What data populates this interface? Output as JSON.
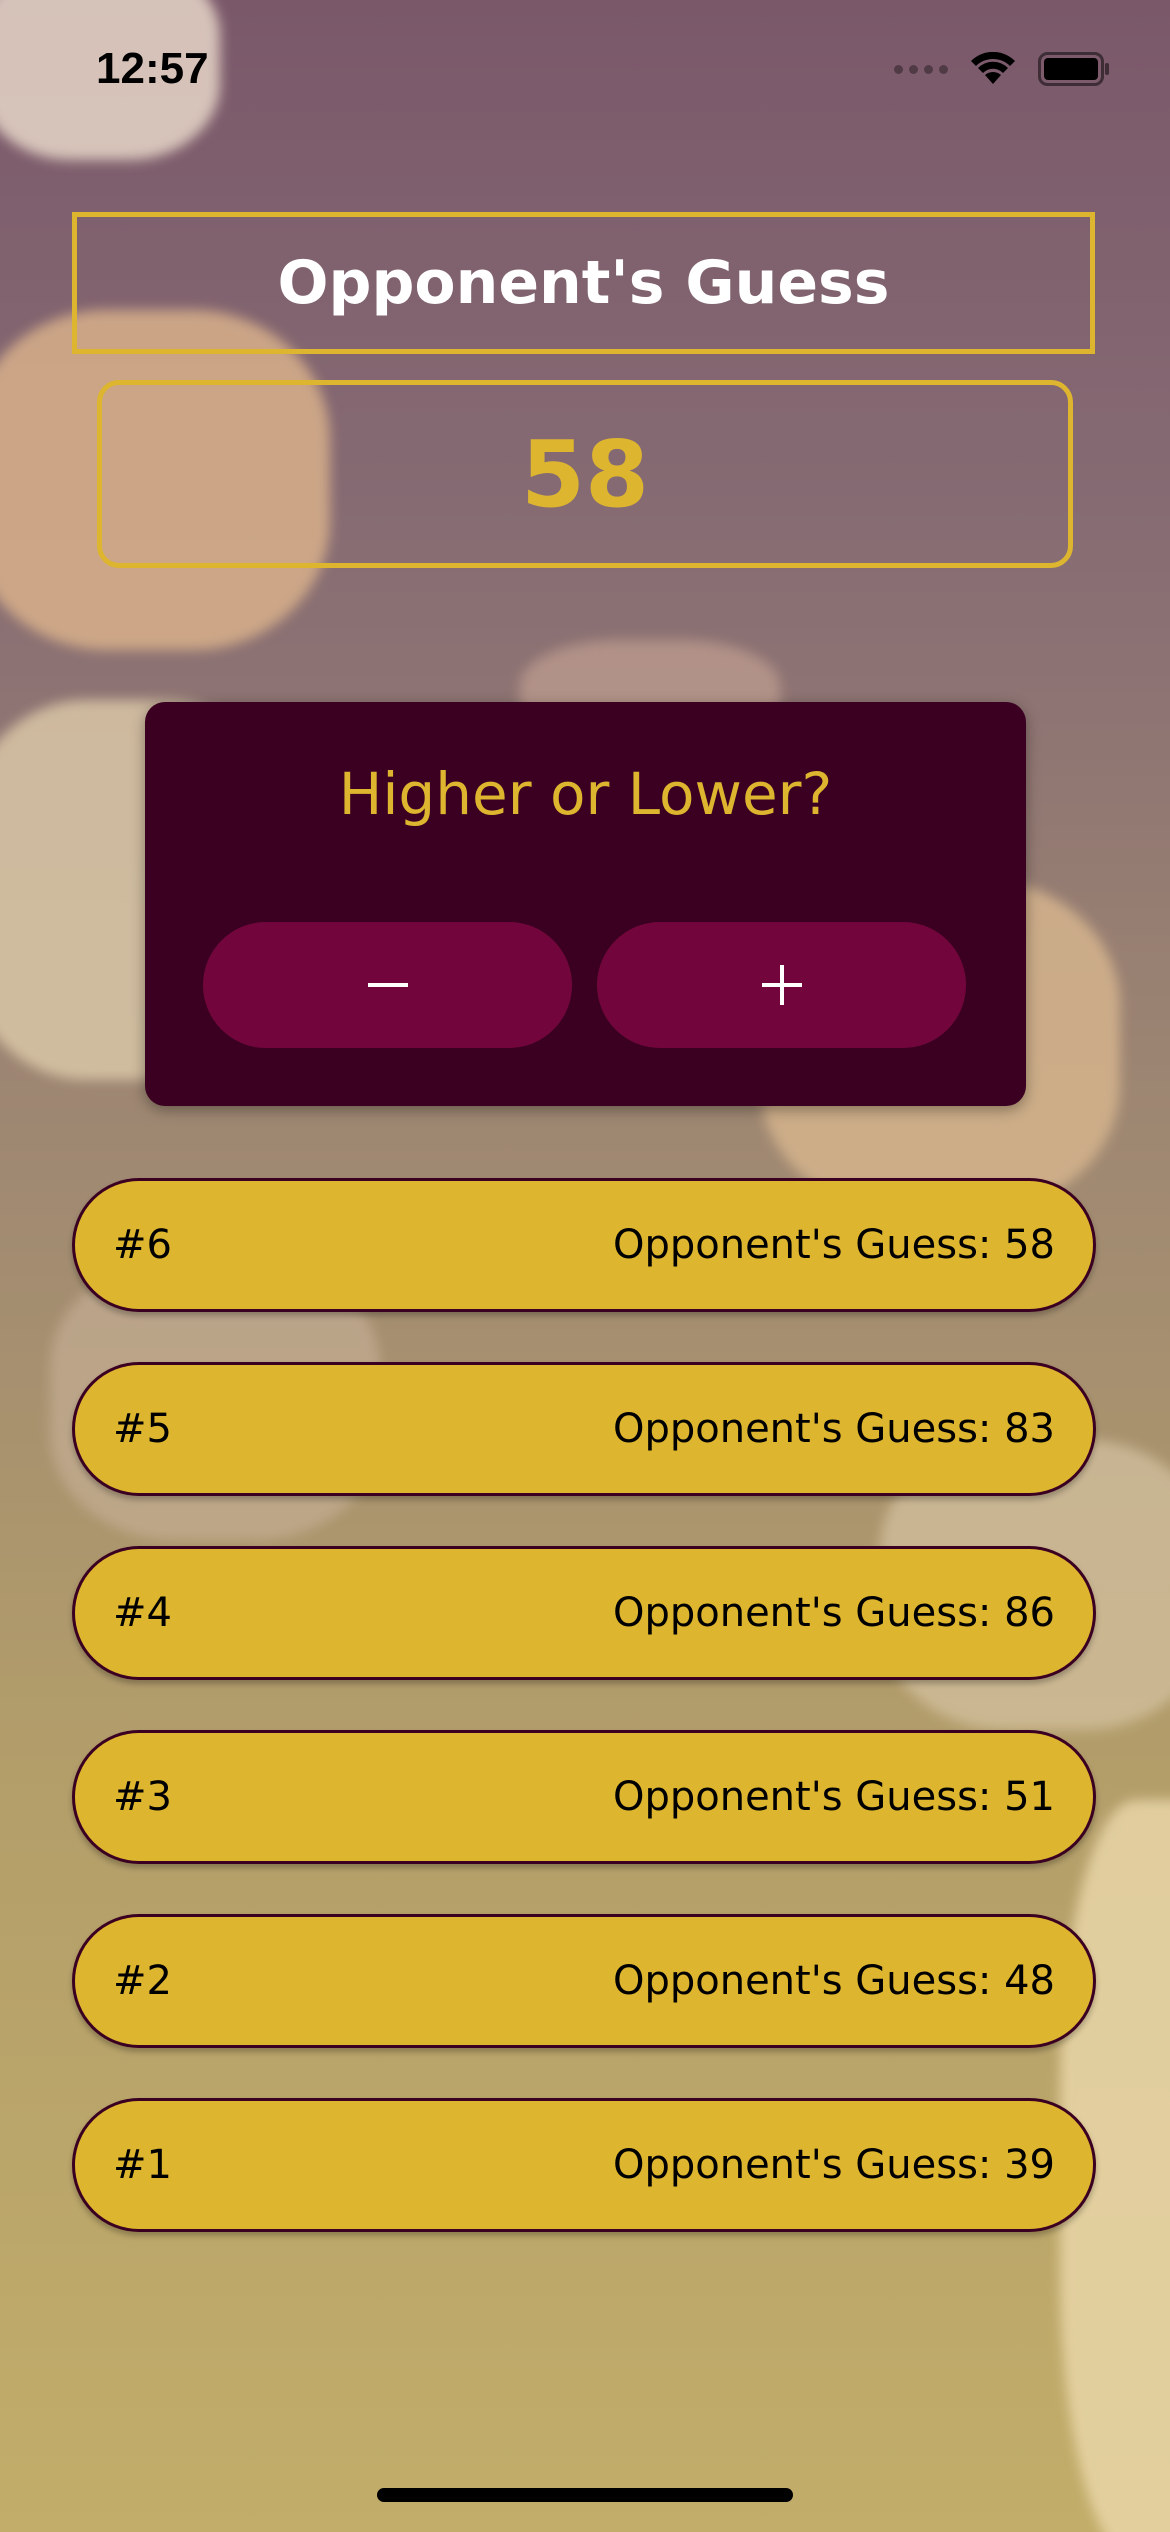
{
  "status_bar": {
    "time": "12:57"
  },
  "screen": {
    "title": "Opponent's Guess",
    "current_guess": "58"
  },
  "controls": {
    "prompt": "Higher or Lower?",
    "lower_icon": "minus-icon",
    "higher_icon": "plus-icon"
  },
  "guess_log": [
    {
      "round": "#6",
      "text": "Opponent's Guess: 58"
    },
    {
      "round": "#5",
      "text": "Opponent's Guess: 83"
    },
    {
      "round": "#4",
      "text": "Opponent's Guess: 86"
    },
    {
      "round": "#3",
      "text": "Opponent's Guess: 51"
    },
    {
      "round": "#2",
      "text": "Opponent's Guess: 48"
    },
    {
      "round": "#1",
      "text": "Opponent's Guess: 39"
    }
  ],
  "colors": {
    "accent": "#ddb52f",
    "card": "#3b0021",
    "button": "#72063c"
  }
}
